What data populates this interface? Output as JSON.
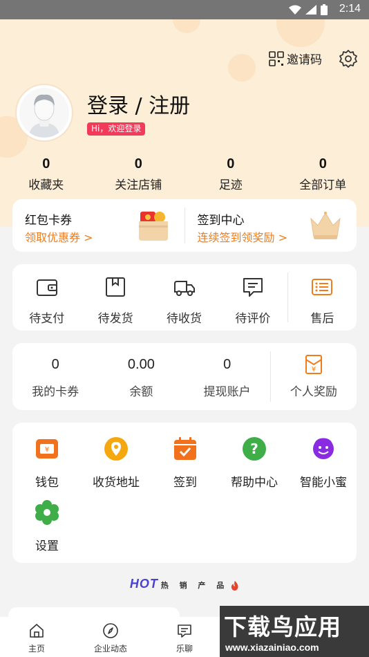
{
  "status_bar": {
    "time": "2:14"
  },
  "header": {
    "invite_label": "邀请码",
    "login_title": "登录 / 注册",
    "welcome_badge": "Hi，欢迎登录"
  },
  "stats": [
    {
      "value": "0",
      "label": "收藏夹"
    },
    {
      "value": "0",
      "label": "关注店铺"
    },
    {
      "value": "0",
      "label": "足迹"
    },
    {
      "value": "0",
      "label": "全部订单"
    }
  ],
  "promo": {
    "coupon": {
      "title": "红包卡券",
      "subtitle": "领取优惠券 >"
    },
    "signin": {
      "title": "签到中心",
      "subtitle": "连续签到领奖励 >"
    }
  },
  "orders": [
    {
      "label": "待支付",
      "icon": "wallet-icon"
    },
    {
      "label": "待发货",
      "icon": "box-icon"
    },
    {
      "label": "待收货",
      "icon": "truck-icon"
    },
    {
      "label": "待评价",
      "icon": "comment-icon"
    },
    {
      "label": "售后",
      "icon": "list-icon"
    }
  ],
  "wallet": [
    {
      "value": "0",
      "label": "我的卡券"
    },
    {
      "value": "0.00",
      "label": "余额"
    },
    {
      "value": "0",
      "label": "提现账户"
    },
    {
      "label": "个人奖励",
      "icon": "reward-icon"
    }
  ],
  "services": [
    {
      "label": "钱包",
      "icon": "wallet-card-icon",
      "color": "#f2711c"
    },
    {
      "label": "收货地址",
      "icon": "location-icon",
      "color": "#f5a70f"
    },
    {
      "label": "签到",
      "icon": "calendar-check-icon",
      "color": "#f2711c"
    },
    {
      "label": "帮助中心",
      "icon": "help-icon",
      "color": "#3fae48"
    },
    {
      "label": "智能小蜜",
      "icon": "headset-icon",
      "color": "#8a2be2"
    },
    {
      "label": "设置",
      "icon": "settings-flower-icon",
      "color": "#3fae48"
    }
  ],
  "hot_section": {
    "logo": "HOT",
    "label": "热 销 产 品"
  },
  "bottom_nav": [
    {
      "label": "主页",
      "icon": "home-icon"
    },
    {
      "label": "企业动态",
      "icon": "compass-icon"
    },
    {
      "label": "乐聊",
      "icon": "chat-icon"
    }
  ],
  "watermark": {
    "title": "下载鸟应用",
    "url": "www.xiazainiao.com"
  },
  "colors": {
    "accent": "#f07c1b",
    "header_bg": "#fdeed8",
    "badge": "#f23b5b"
  }
}
